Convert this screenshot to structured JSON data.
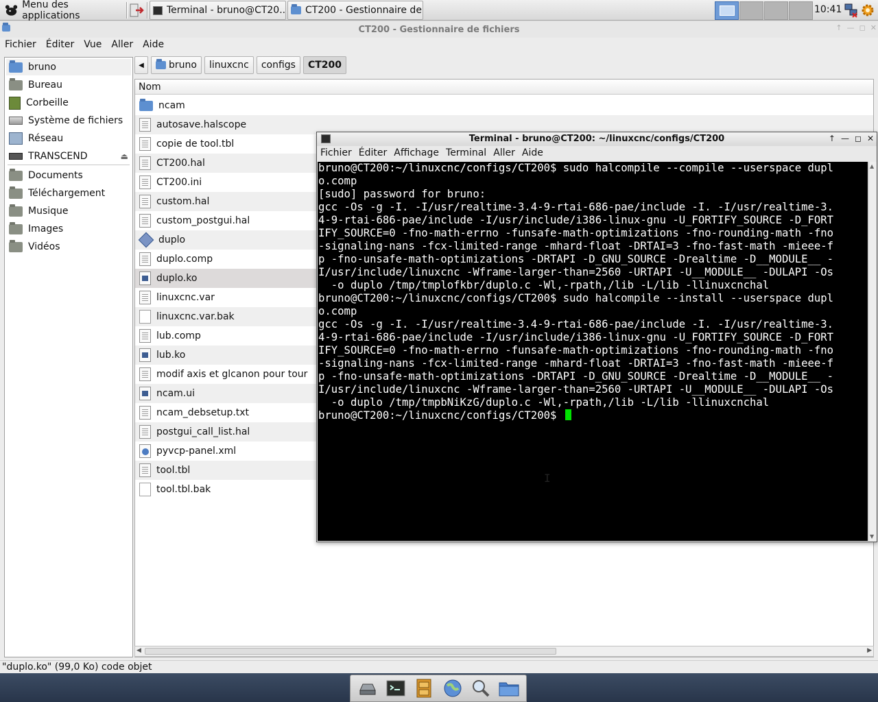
{
  "top_panel": {
    "app_menu_label": "Menu des applications",
    "tasks": [
      {
        "label": "Terminal - bruno@CT20..."
      },
      {
        "label": "CT200 - Gestionnaire de..."
      }
    ],
    "clock": "10:41"
  },
  "file_manager": {
    "window_title": "CT200 - Gestionnaire de fichiers",
    "menu": [
      "Fichier",
      "Éditer",
      "Vue",
      "Aller",
      "Aide"
    ],
    "sidebar": {
      "places": [
        {
          "label": "bruno",
          "icon": "home-folder-icon"
        },
        {
          "label": "Bureau",
          "icon": "desktop-icon"
        },
        {
          "label": "Corbeille",
          "icon": "trash-icon"
        },
        {
          "label": "Système de fichiers",
          "icon": "harddisk-icon"
        },
        {
          "label": "Réseau",
          "icon": "network-icon"
        },
        {
          "label": "TRANSCEND",
          "icon": "usb-drive-icon"
        }
      ],
      "bookmarks": [
        {
          "label": "Documents",
          "icon": "folder-icon"
        },
        {
          "label": "Téléchargement",
          "icon": "folder-icon"
        },
        {
          "label": "Musique",
          "icon": "folder-icon"
        },
        {
          "label": "Images",
          "icon": "folder-icon"
        },
        {
          "label": "Vidéos",
          "icon": "folder-icon"
        }
      ]
    },
    "path": [
      "bruno",
      "linuxcnc",
      "configs",
      "CT200"
    ],
    "column_header": "Nom",
    "files": [
      {
        "name": "ncam",
        "icon": "folder"
      },
      {
        "name": "autosave.halscope",
        "icon": "doc"
      },
      {
        "name": "copie de tool.tbl",
        "icon": "doc"
      },
      {
        "name": "CT200.hal",
        "icon": "doc"
      },
      {
        "name": "CT200.ini",
        "icon": "doc"
      },
      {
        "name": "custom.hal",
        "icon": "doc"
      },
      {
        "name": "custom_postgui.hal",
        "icon": "doc"
      },
      {
        "name": "duplo",
        "icon": "exec"
      },
      {
        "name": "duplo.comp",
        "icon": "doc"
      },
      {
        "name": "duplo.ko",
        "icon": "module"
      },
      {
        "name": "linuxcnc.var",
        "icon": "doc"
      },
      {
        "name": "linuxcnc.var.bak",
        "icon": "blank"
      },
      {
        "name": "lub.comp",
        "icon": "doc"
      },
      {
        "name": "lub.ko",
        "icon": "module"
      },
      {
        "name": "modif axis et glcanon pour tour",
        "icon": "doc"
      },
      {
        "name": "ncam.ui",
        "icon": "module"
      },
      {
        "name": "ncam_debsetup.txt",
        "icon": "doc"
      },
      {
        "name": "postgui_call_list.hal",
        "icon": "doc"
      },
      {
        "name": "pyvcp-panel.xml",
        "icon": "xml"
      },
      {
        "name": "tool.tbl",
        "icon": "doc"
      },
      {
        "name": "tool.tbl.bak",
        "icon": "blank"
      }
    ],
    "selected_file": "duplo.ko",
    "status": "\"duplo.ko\" (99,0 Ko) code objet"
  },
  "terminal": {
    "window_title": "Terminal - bruno@CT200: ~/linuxcnc/configs/CT200",
    "menu": [
      "Fichier",
      "Éditer",
      "Affichage",
      "Terminal",
      "Aller",
      "Aide"
    ],
    "lines": [
      "bruno@CT200:~/linuxcnc/configs/CT200$ sudo halcompile --compile --userspace dupl",
      "o.comp",
      "[sudo] password for bruno:",
      "gcc -Os -g -I. -I/usr/realtime-3.4-9-rtai-686-pae/include -I. -I/usr/realtime-3.",
      "4-9-rtai-686-pae/include -I/usr/include/i386-linux-gnu -U_FORTIFY_SOURCE -D_FORT",
      "IFY_SOURCE=0 -fno-math-errno -funsafe-math-optimizations -fno-rounding-math -fno",
      "-signaling-nans -fcx-limited-range -mhard-float -DRTAI=3 -fno-fast-math -mieee-f",
      "p -fno-unsafe-math-optimizations -DRTAPI -D_GNU_SOURCE -Drealtime -D__MODULE__ -",
      "I/usr/include/linuxcnc -Wframe-larger-than=2560 -URTAPI -U__MODULE__ -DULAPI -Os",
      "  -o duplo /tmp/tmplofkbr/duplo.c -Wl,-rpath,/lib -L/lib -llinuxcnchal",
      "bruno@CT200:~/linuxcnc/configs/CT200$ sudo halcompile --install --userspace dupl",
      "o.comp",
      "gcc -Os -g -I. -I/usr/realtime-3.4-9-rtai-686-pae/include -I. -I/usr/realtime-3.",
      "4-9-rtai-686-pae/include -I/usr/include/i386-linux-gnu -U_FORTIFY_SOURCE -D_FORT",
      "IFY_SOURCE=0 -fno-math-errno -funsafe-math-optimizations -fno-rounding-math -fno",
      "-signaling-nans -fcx-limited-range -mhard-float -DRTAI=3 -fno-fast-math -mieee-f",
      "p -fno-unsafe-math-optimizations -DRTAPI -D_GNU_SOURCE -Drealtime -D__MODULE__ -",
      "I/usr/include/linuxcnc -Wframe-larger-than=2560 -URTAPI -U__MODULE__ -DULAPI -Os",
      "  -o duplo /tmp/tmpbNiKzG/duplo.c -Wl,-rpath,/lib -L/lib -llinuxcnchal"
    ],
    "prompt": "bruno@CT200:~/linuxcnc/configs/CT200$ ",
    "cursor_color": "#00e000"
  },
  "dock": {
    "items": [
      "drive-icon",
      "terminal-icon",
      "file-cabinet-icon",
      "web-browser-icon",
      "search-icon",
      "file-manager-icon"
    ]
  }
}
